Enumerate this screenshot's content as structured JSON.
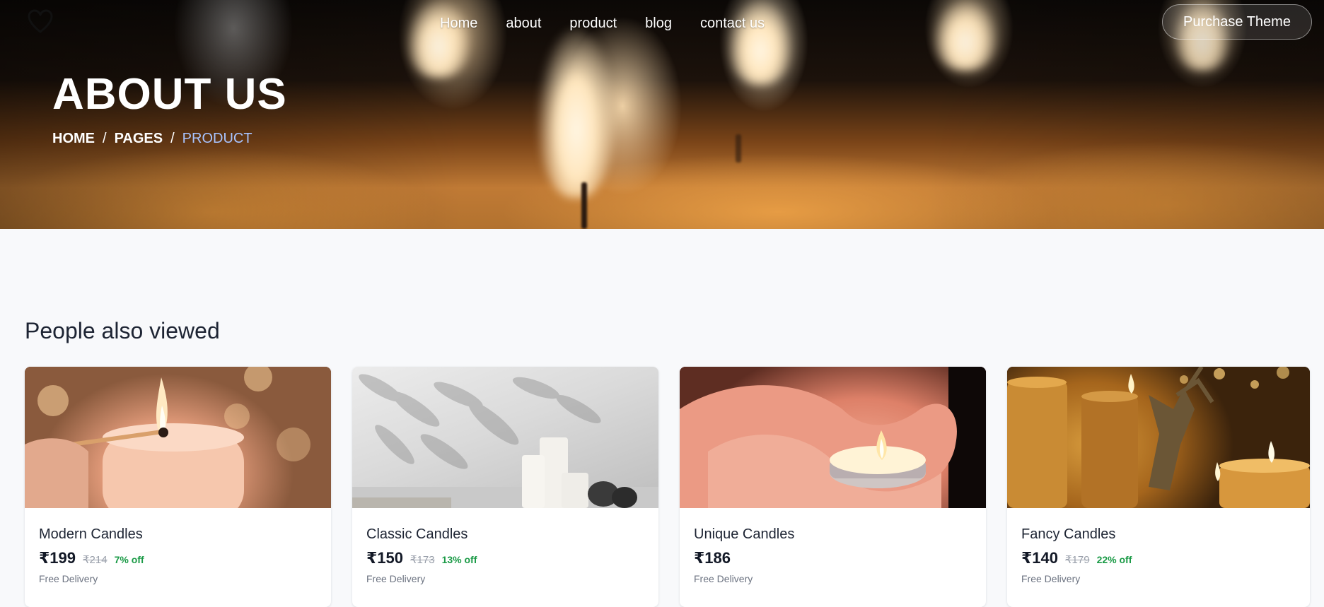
{
  "nav": {
    "logo": "heart-icon",
    "links": [
      "Home",
      "about",
      "product",
      "blog",
      "contact us"
    ],
    "cta": "Purchase Theme"
  },
  "hero": {
    "title": "ABOUT US",
    "breadcrumb": [
      "HOME",
      "PAGES",
      "PRODUCT"
    ],
    "separator": "/"
  },
  "section": {
    "title": "People also viewed",
    "products": [
      {
        "name": "Modern Candles",
        "price": "₹199",
        "mrp": "₹214",
        "discount": "7% off",
        "delivery": "Free Delivery"
      },
      {
        "name": "Classic Candles",
        "price": "₹150",
        "mrp": "₹173",
        "discount": "13% off",
        "delivery": "Free Delivery"
      },
      {
        "name": "Unique Candles",
        "price": "₹186",
        "mrp": "",
        "discount": "",
        "delivery": "Free Delivery"
      },
      {
        "name": "Fancy Candles",
        "price": "₹140",
        "mrp": "₹179",
        "discount": "22% off",
        "delivery": "Free Delivery"
      }
    ]
  },
  "colors": {
    "accent_breadcrumb": "#a8c4ff",
    "discount_green": "#1a9a46",
    "page_bg": "#f8f9fb"
  }
}
